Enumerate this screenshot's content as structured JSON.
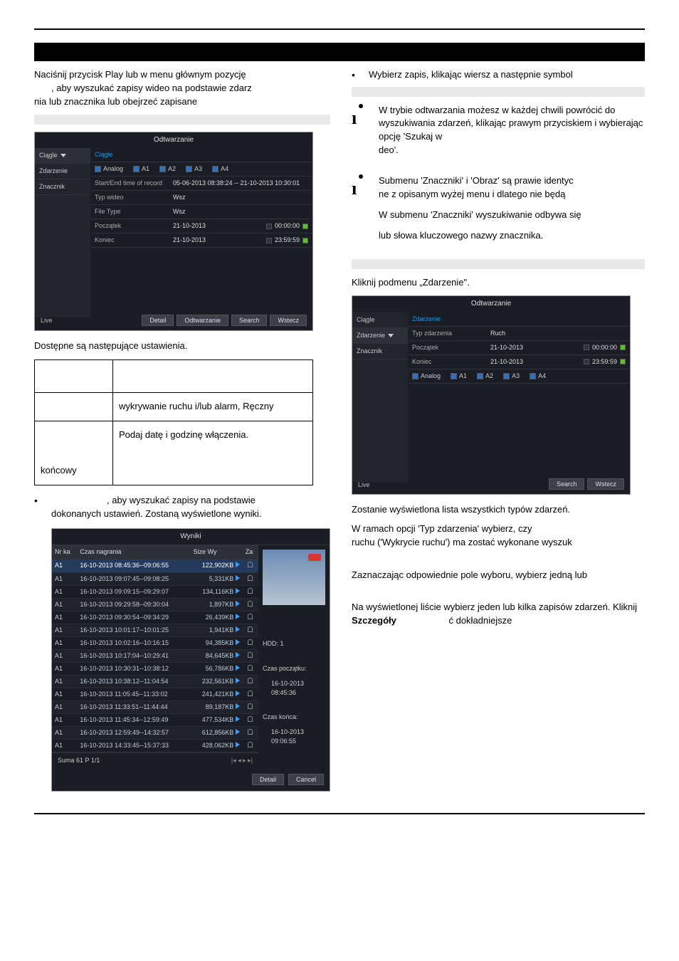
{
  "top": {
    "para1a": "Naciśnij przycisk Play lub w menu głównym pozycję",
    "para1b": ", aby wyszukać zapisy wideo na podstawie zdarz",
    "para1c": "nia lub znacznika lub obejrzeć zapisane"
  },
  "shot1": {
    "title": "Odtwarzanie",
    "side_items": [
      "Ciągle",
      "Zdarzenie",
      "Znacznik"
    ],
    "ciagle": "Ciągle",
    "analog_label": "Analog",
    "chks": [
      "A1",
      "A2",
      "A3",
      "A4"
    ],
    "rows": {
      "rec_time_label": "Start/End time of record",
      "rec_time_value": "05-06-2013 08:38:24 -- 21-10-2013 10:30:01",
      "type_label": "Typ wideo",
      "type_value": "Wsz",
      "filetype_label": "File Type",
      "filetype_value": "Wsz",
      "start_label": "Początek",
      "start_value": "21-10-2013",
      "start_time": "00:00:00",
      "end_label": "Koniec",
      "end_value": "21-10-2013",
      "end_time": "23:59:59"
    },
    "footer": [
      "Detail",
      "Odtwarzanie",
      "Search",
      "Wstecz"
    ],
    "live": "Live"
  },
  "caption1": "Dostępne są następujące ustawienia.",
  "settings": {
    "row1_val": "wykrywanie ruchu i/lub alarm, Ręczny",
    "row2_val": "Podaj datę i godzinę włączenia.",
    "row2_lbl": "końcowy"
  },
  "search_para_a": ", aby wyszukać zapisy na podstawie",
  "search_para_b": "dokonanych ustawień. Zostaną wyświetlone wyniki.",
  "shot2": {
    "title": "Wyniki",
    "cols": [
      "Nr ka",
      "Czas nagrania",
      "Size Wy",
      "Za"
    ],
    "rows": [
      {
        "cam": "A1",
        "time": "16-10-2013 08:45:36--09:06:55",
        "size": "122,902KB"
      },
      {
        "cam": "A1",
        "time": "16-10-2013 09:07:45--09:08:25",
        "size": "5,331KB"
      },
      {
        "cam": "A1",
        "time": "16-10-2013 09:09:15--09:29:07",
        "size": "134,116KB"
      },
      {
        "cam": "A1",
        "time": "16-10-2013 09:29:58--09:30:04",
        "size": "1,897KB"
      },
      {
        "cam": "A1",
        "time": "16-10-2013 09:30:54--09:34:29",
        "size": "26,439KB"
      },
      {
        "cam": "A1",
        "time": "16-10-2013 10:01:17--10:01:25",
        "size": "1,941KB"
      },
      {
        "cam": "A1",
        "time": "16-10-2013 10:02:16--10:16:15",
        "size": "94,385KB"
      },
      {
        "cam": "A1",
        "time": "16-10-2013 10:17:04--10:29:41",
        "size": "84,645KB"
      },
      {
        "cam": "A1",
        "time": "16-10-2013 10:30:31--10:38:12",
        "size": "56,786KB"
      },
      {
        "cam": "A1",
        "time": "16-10-2013 10:38:12--11:04:54",
        "size": "232,561KB"
      },
      {
        "cam": "A1",
        "time": "16-10-2013 11:05:45--11:33:02",
        "size": "241,421KB"
      },
      {
        "cam": "A1",
        "time": "16-10-2013 11:33:51--11:44:44",
        "size": "89,187KB"
      },
      {
        "cam": "A1",
        "time": "16-10-2013 11:45:34--12:59:49",
        "size": "477,534KB"
      },
      {
        "cam": "A1",
        "time": "16-10-2013 12:59:49--14:32:57",
        "size": "612,856KB"
      },
      {
        "cam": "A1",
        "time": "16-10-2013 14:33:45--15:37:33",
        "size": "428,062KB"
      }
    ],
    "summary": "Suma 61 P 1/1",
    "right": {
      "hdd": "HDD: 1",
      "start_lbl": "Czas początku:",
      "start_val": "16-10-2013 08:45:36",
      "end_lbl": "Czas końca:",
      "end_val": "16-10-2013 09:06:55"
    },
    "btns": [
      "Detail",
      "Cancel"
    ]
  },
  "right_col": {
    "bullet1": "Wybierz zapis, klikając wiersz a następnie symbol",
    "info1_a": "W trybie odtwarzania możesz w każdej chwili powrócić do wyszukiwania zdarzeń, klikając prawym przyciskiem i wybierając opcję 'Szukaj w",
    "info1_b": "deo'.",
    "info2_a": "Submenu 'Znaczniki' i 'Obraz' są prawie identyc",
    "info2_b": "ne z opisanym wyżej menu i dlatego nie będą",
    "info2_c": "W submenu 'Znaczniki' wyszukiwanie odbywa się",
    "info2_d": "lub słowa kluczowego nazwy znacznika.",
    "zdarzenie_intro": "Kliknij podmenu „Zdarzenie\".",
    "para_after_shot3": "Zostanie wyświetlona lista wszystkich typów zdarzeń.",
    "para2a": "W ramach opcji 'Typ zdarzenia' wybierz, czy",
    "para2b": "ruchu ('Wykrycie ruchu')  ma zostać wykonane wyszuk",
    "para3": "Zaznaczając odpowiednie pole wyboru, wybierz jedną lub",
    "para4a": "Na wyświetlonej liście wybierz jeden lub kilka zapisów zdarzeń. Kliknij ",
    "para4b": "Szczegóły",
    "para4c": "ć dokładniejsze"
  },
  "shot3": {
    "title": "Odtwarzanie",
    "side": [
      "Ciągle",
      "Zdarzenie",
      "Znacznik"
    ],
    "sel": "Zdarzenie",
    "rows": {
      "type_lbl": "Typ zdarzenia",
      "type_val": "Ruch",
      "start_lbl": "Początek",
      "start_val": "21-10-2013",
      "start_time": "00:00:00",
      "end_lbl": "Koniec",
      "end_val": "21-10-2013",
      "end_time": "23:59:59",
      "analog": "Analog",
      "chks": [
        "A1",
        "A2",
        "A3",
        "A4"
      ]
    },
    "btns": [
      "Search",
      "Wstecz"
    ],
    "live": "Live"
  }
}
